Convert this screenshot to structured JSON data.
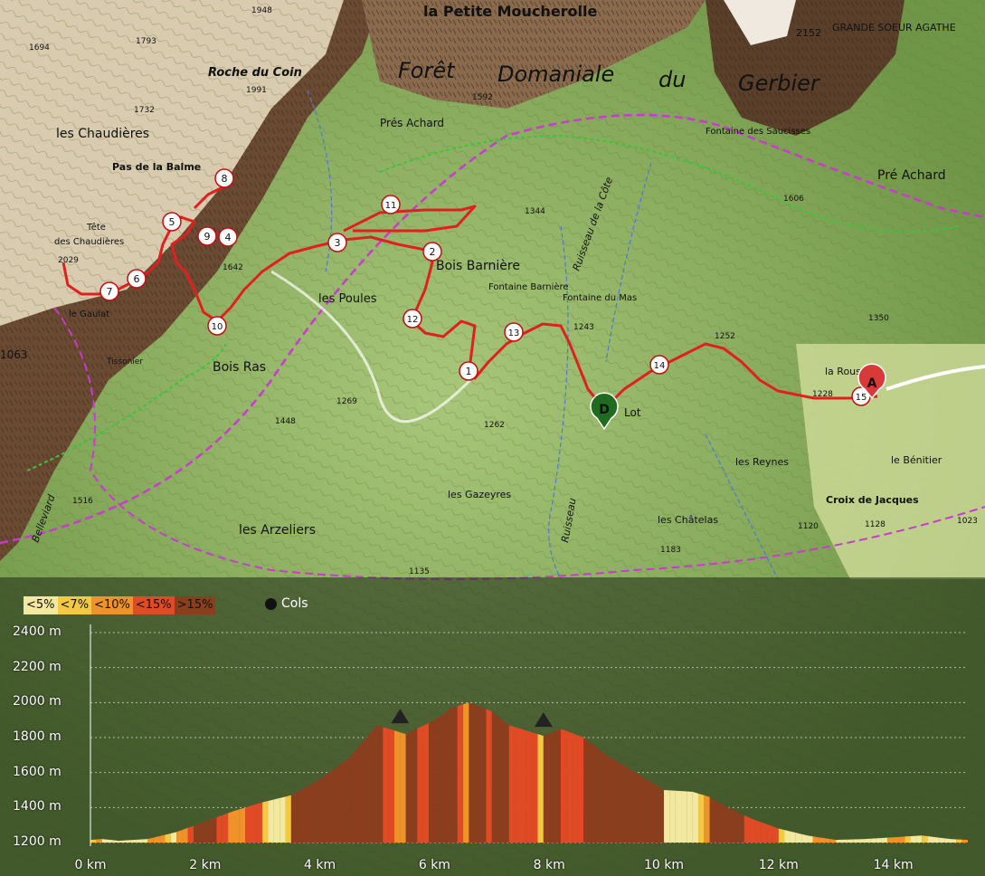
{
  "map": {
    "places": [
      {
        "name": "la Petite Moucherolle",
        "italic": false
      },
      {
        "name": "Forêt",
        "italic": true
      },
      {
        "name": "Domaniale",
        "italic": true
      },
      {
        "name": "du",
        "italic": true
      },
      {
        "name": "Gerbier",
        "italic": true
      },
      {
        "name": "Roche du Coin",
        "italic": true
      },
      {
        "name": "les Chaudières",
        "italic": false
      },
      {
        "name": "Pas de la Balme",
        "italic": false
      },
      {
        "name": "Tête",
        "italic": false
      },
      {
        "name": "des Chaudières",
        "italic": false
      },
      {
        "name": "Prés Achard",
        "italic": false
      },
      {
        "name": "Pré Achard",
        "italic": false
      },
      {
        "name": "Bois Barnière",
        "italic": false
      },
      {
        "name": "les Poules",
        "italic": false
      },
      {
        "name": "Bois Ras",
        "italic": false
      },
      {
        "name": "Tissonier",
        "italic": false
      },
      {
        "name": "le Gaulat",
        "italic": false
      },
      {
        "name": "les Gazeyres",
        "italic": false
      },
      {
        "name": "les Arzeliers",
        "italic": false
      },
      {
        "name": "les Reynes",
        "italic": false
      },
      {
        "name": "les Châtelas",
        "italic": false
      },
      {
        "name": "Croix de Jacques",
        "italic": false
      },
      {
        "name": "le Bénitier",
        "italic": false
      },
      {
        "name": "la Rous",
        "italic": false
      },
      {
        "name": "Lot",
        "italic": false
      },
      {
        "name": "Fontaine Barnière",
        "italic": false
      },
      {
        "name": "Fontaine du Mas",
        "italic": false
      },
      {
        "name": "Fontaine des Saucisses",
        "italic": false
      },
      {
        "name": "GRANDE SOEUR AGATHE",
        "italic": false
      },
      {
        "name": "Ruisseau de la Côte",
        "italic": true
      },
      {
        "name": "Ruisseau",
        "italic": true
      },
      {
        "name": "Belleviard",
        "italic": true
      }
    ],
    "spot_heights": [
      "1694",
      "1793",
      "1948",
      "1991",
      "1732",
      "2029",
      "1642",
      "1592",
      "1344",
      "1243",
      "1252",
      "1228",
      "1350",
      "1269",
      "1448",
      "1262",
      "1135",
      "1183",
      "1120",
      "1128",
      "1606",
      "1023",
      "1516",
      "1063",
      "2152",
      "1135"
    ],
    "waypoints": [
      "1",
      "2",
      "3",
      "4",
      "5",
      "6",
      "7",
      "8",
      "9",
      "10",
      "11",
      "12",
      "13",
      "14",
      "15"
    ],
    "start_marker": "D",
    "end_marker": "A"
  },
  "profile": {
    "legend": [
      {
        "label": "<5%",
        "color": "#f3e8a0"
      },
      {
        "label": "<7%",
        "color": "#f5c842"
      },
      {
        "label": "<10%",
        "color": "#f0922a"
      },
      {
        "label": "<15%",
        "color": "#e04b25"
      },
      {
        "label": ">15%",
        "color": "#8b3e1e"
      }
    ],
    "cols_label": "Cols"
  },
  "chart_data": {
    "type": "area",
    "x": [
      0,
      0.2,
      0.5,
      1,
      1.5,
      2,
      2.5,
      3,
      3.5,
      4,
      4.5,
      5,
      5.3,
      5.5,
      6,
      6.3,
      6.6,
      7,
      7.3,
      7.6,
      7.9,
      8.2,
      8.6,
      9,
      9.5,
      10,
      10.5,
      10.8,
      11,
      11.5,
      12,
      12.5,
      13,
      13.5,
      14,
      14.5,
      15,
      15.3
    ],
    "y": [
      1215,
      1220,
      1210,
      1220,
      1260,
      1320,
      1380,
      1430,
      1470,
      1560,
      1680,
      1870,
      1840,
      1820,
      1900,
      1970,
      2000,
      1950,
      1870,
      1840,
      1810,
      1850,
      1800,
      1700,
      1600,
      1500,
      1490,
      1460,
      1420,
      1340,
      1280,
      1240,
      1215,
      1220,
      1230,
      1240,
      1220,
      1215
    ],
    "xlabel": "",
    "ylabel": "",
    "ylim": [
      1200,
      2400
    ],
    "xlim": [
      0,
      15.3
    ],
    "yticks": [
      "1200 m",
      "1400 m",
      "1600 m",
      "1800 m",
      "2000 m",
      "2200 m",
      "2400 m"
    ],
    "xticks": [
      "0 km",
      "2 km",
      "4 km",
      "6 km",
      "8 km",
      "10 km",
      "12 km",
      "14 km"
    ],
    "cols_at_km": [
      5.4,
      7.9
    ],
    "grid": true
  }
}
